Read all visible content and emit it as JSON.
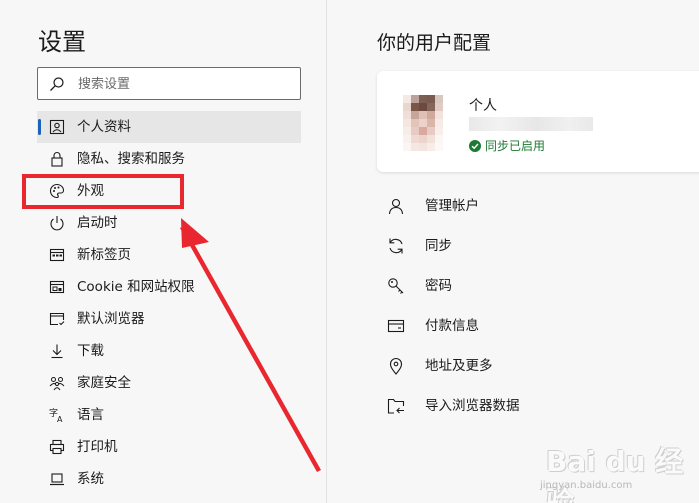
{
  "sidebar": {
    "title": "设置",
    "search": {
      "placeholder": "搜索设置",
      "value": ""
    },
    "items": [
      {
        "label": "个人资料",
        "icon": "profile-card-icon",
        "active": true
      },
      {
        "label": "隐私、搜索和服务",
        "icon": "lock-icon"
      },
      {
        "label": "外观",
        "icon": "palette-icon"
      },
      {
        "label": "启动时",
        "icon": "power-icon"
      },
      {
        "label": "新标签页",
        "icon": "new-tab-icon"
      },
      {
        "label": "Cookie 和网站权限",
        "icon": "site-permissions-icon"
      },
      {
        "label": "默认浏览器",
        "icon": "browser-icon"
      },
      {
        "label": "下载",
        "icon": "download-icon"
      },
      {
        "label": "家庭安全",
        "icon": "family-icon"
      },
      {
        "label": "语言",
        "icon": "language-icon"
      },
      {
        "label": "打印机",
        "icon": "printer-icon"
      },
      {
        "label": "系统",
        "icon": "laptop-icon"
      }
    ]
  },
  "main": {
    "heading": "你的用户配置",
    "profile": {
      "name": "个人",
      "sync_status": "同步已启用"
    },
    "items": [
      {
        "label": "管理帐户",
        "icon": "person-icon"
      },
      {
        "label": "同步",
        "icon": "sync-icon"
      },
      {
        "label": "密码",
        "icon": "key-icon"
      },
      {
        "label": "付款信息",
        "icon": "credit-card-icon"
      },
      {
        "label": "地址及更多",
        "icon": "location-pin-icon"
      },
      {
        "label": "导入浏览器数据",
        "icon": "import-icon"
      }
    ]
  },
  "annotation": {
    "highlight_color": "#e8272f"
  },
  "watermark": {
    "brand": "Bai du 经验",
    "url": "jingyan.baidu.com"
  },
  "colors": {
    "accent": "#1a63b8",
    "sync_green": "#1e7a33",
    "sidebar_bg": "#f7f7f7",
    "active_bg": "#e6e6e6"
  }
}
